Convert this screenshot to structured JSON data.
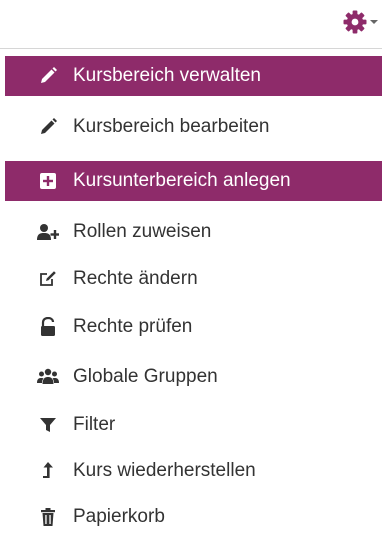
{
  "menu": {
    "trigger_icon": "gear-icon",
    "accent_color": "#8e2b6a",
    "items": [
      {
        "label": "Kursbereich verwalten",
        "icon": "pencil-icon",
        "highlighted": true
      },
      {
        "label": "Kursbereich bearbeiten",
        "icon": "pencil-icon",
        "highlighted": false
      },
      {
        "label": "Kursunterbereich anlegen",
        "icon": "plus-square-icon",
        "highlighted": true
      },
      {
        "label": "Rollen zuweisen",
        "icon": "user-plus-icon",
        "highlighted": false
      },
      {
        "label": "Rechte ändern",
        "icon": "edit-box-icon",
        "highlighted": false
      },
      {
        "label": "Rechte prüfen",
        "icon": "unlock-icon",
        "highlighted": false
      },
      {
        "label": "Globale Gruppen",
        "icon": "users-icon",
        "highlighted": false
      },
      {
        "label": "Filter",
        "icon": "filter-icon",
        "highlighted": false
      },
      {
        "label": "Kurs wiederherstellen",
        "icon": "level-up-icon",
        "highlighted": false
      },
      {
        "label": "Papierkorb",
        "icon": "trash-icon",
        "highlighted": false
      }
    ]
  }
}
